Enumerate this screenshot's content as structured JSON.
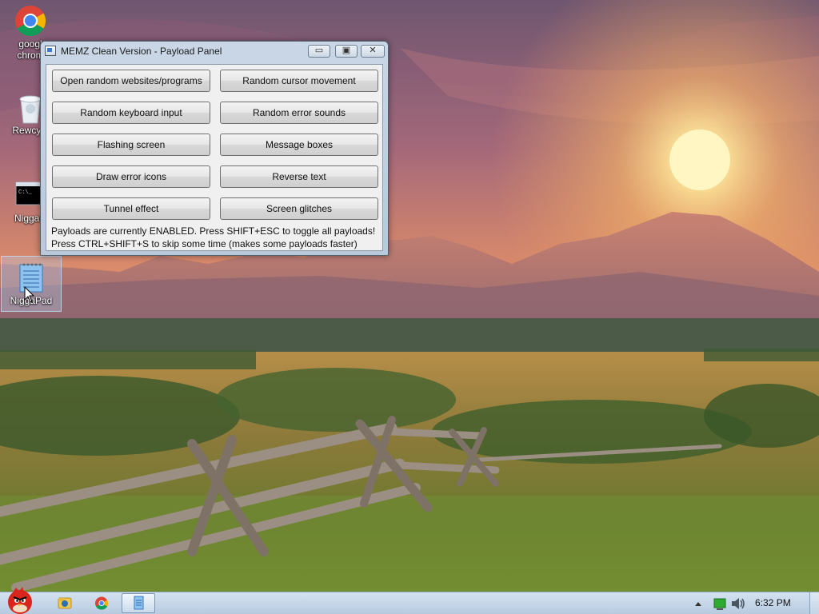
{
  "window": {
    "title": "MEMZ Clean Version - Payload Panel",
    "controls": {
      "minimize": "▭",
      "maximize": "▣",
      "close": "✕"
    },
    "buttons": [
      "Open random websites/programs",
      "Random cursor movement",
      "Random keyboard input",
      "Random error sounds",
      "Flashing screen",
      "Message boxes",
      "Draw error icons",
      "Reverse text",
      "Tunnel effect",
      "Screen glitches"
    ],
    "info_line1": "Payloads are currently ENABLED. Press SHIFT+ESC to toggle all payloads!",
    "info_line2": "Press CTRL+SHIFT+S to skip some time (makes some payloads faster)"
  },
  "desktop": {
    "icons": [
      {
        "label1": "googl",
        "label2": "chrom",
        "icon": "chrome-icon"
      },
      {
        "label1": "Rewcyle",
        "label2": "",
        "icon": "recycle-bin-icon"
      },
      {
        "label1": "NiggaC",
        "label2": "",
        "icon": "command-prompt-icon"
      },
      {
        "label1": "NiggaPad",
        "label2": "",
        "icon": "notepad-icon"
      }
    ]
  },
  "taskbar": {
    "start_icon": "angry-bird-start-icon",
    "pinned": [
      "explorer-icon",
      "chrome-icon",
      "notepad-icon"
    ],
    "tray": {
      "icons": [
        "show-hidden-icons-icon",
        "network-icon",
        "speaker-icon"
      ]
    },
    "clock": "6:32 PM"
  },
  "colors": {
    "taskbar_top": "#d4e2f0",
    "window_frame": "#c9d7e6",
    "sky_top": "#7a5a73",
    "sun": "#fff2b0"
  }
}
